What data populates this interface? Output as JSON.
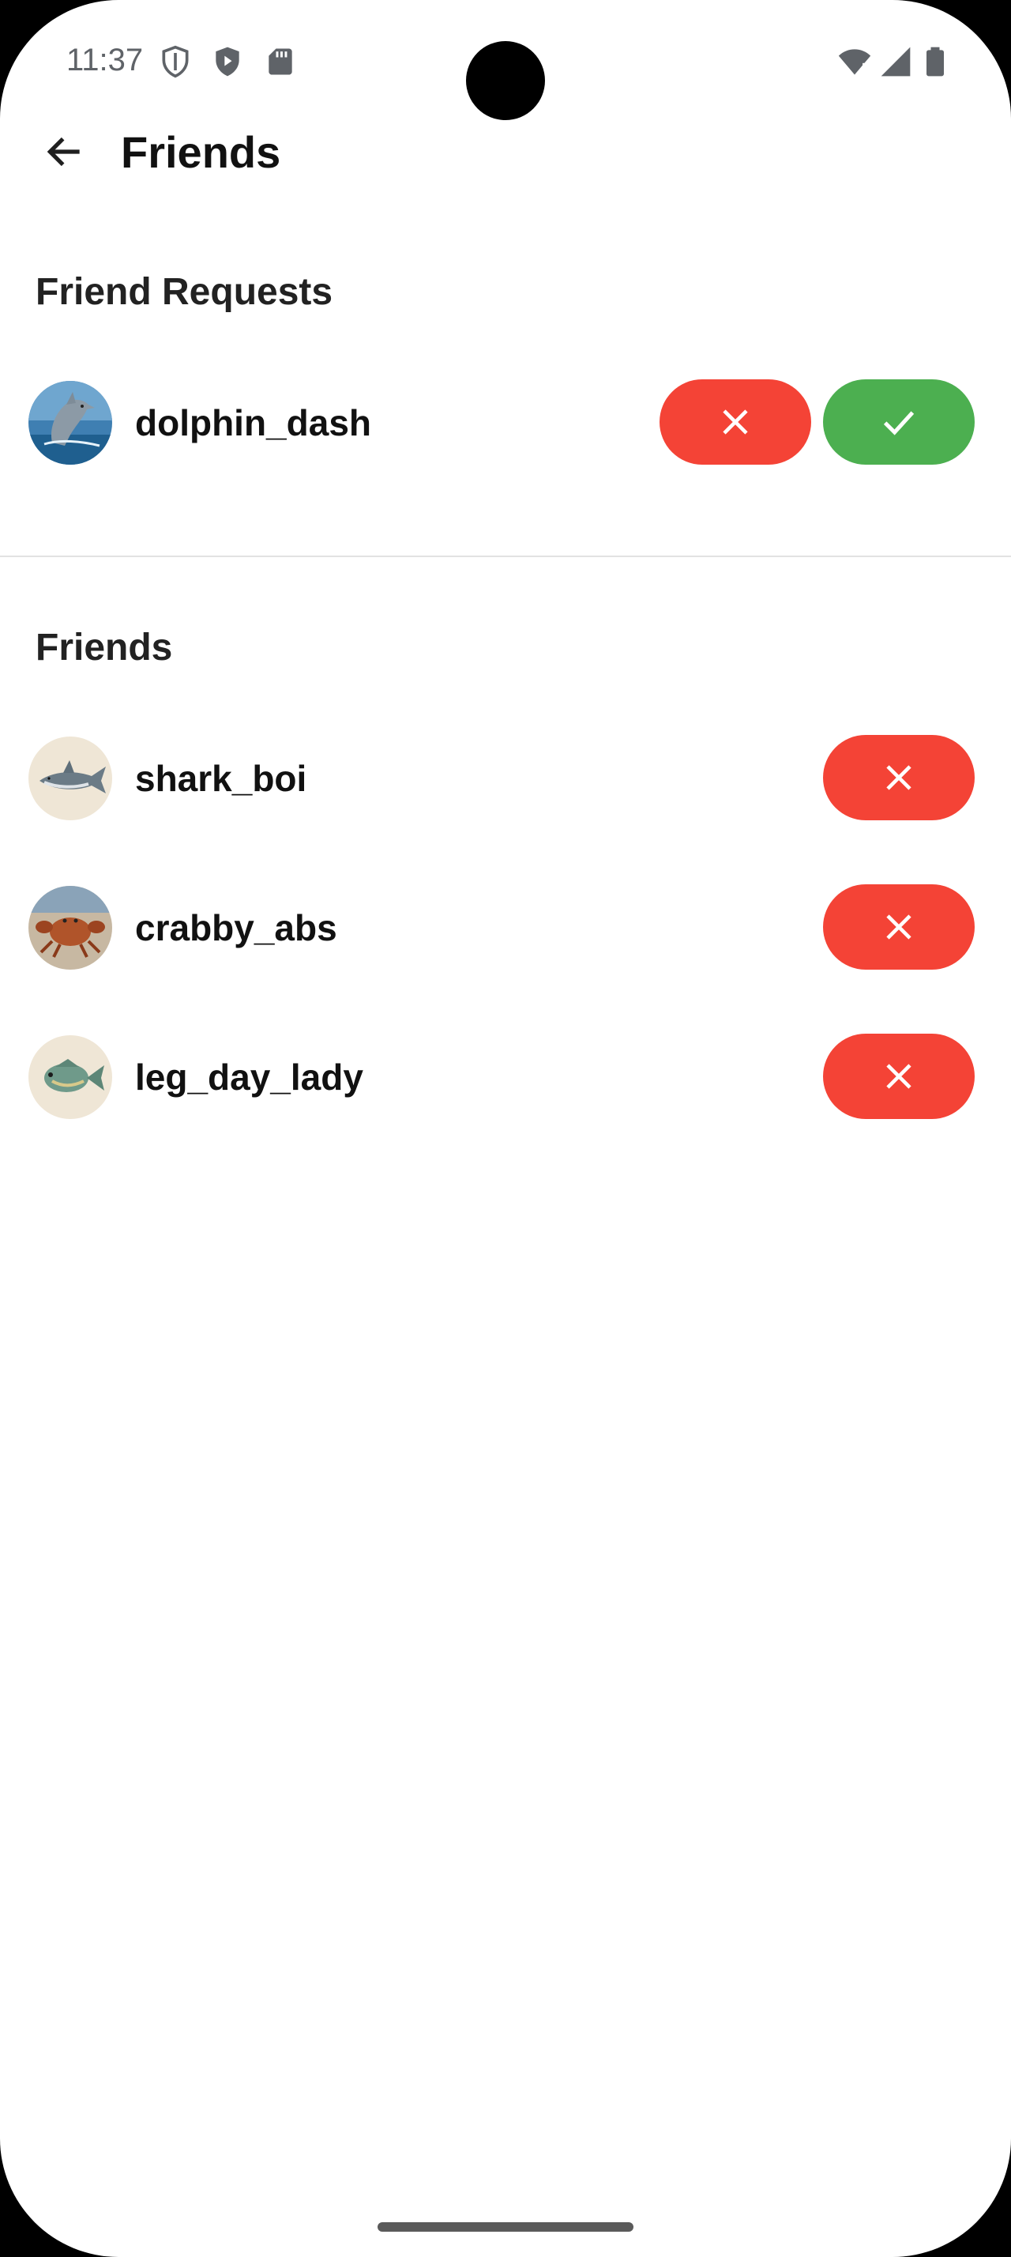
{
  "status_bar": {
    "time": "11:37",
    "icons": [
      "vpn-shield-icon",
      "play-protect-icon",
      "sd-card-icon",
      "wifi-alert-icon",
      "signal-icon",
      "battery-icon"
    ]
  },
  "app_bar": {
    "title": "Friends",
    "back_icon": "arrow-back-icon"
  },
  "friend_requests": {
    "title": "Friend Requests",
    "items": [
      {
        "username": "dolphin_dash",
        "avatar": "dolphin"
      }
    ]
  },
  "friends": {
    "title": "Friends",
    "items": [
      {
        "username": "shark_boi",
        "avatar": "shark"
      },
      {
        "username": "crabby_abs",
        "avatar": "crab"
      },
      {
        "username": "leg_day_lady",
        "avatar": "fish"
      }
    ]
  },
  "colors": {
    "decline": "#f44336",
    "accept": "#4caf50",
    "background": "#ffffff"
  }
}
